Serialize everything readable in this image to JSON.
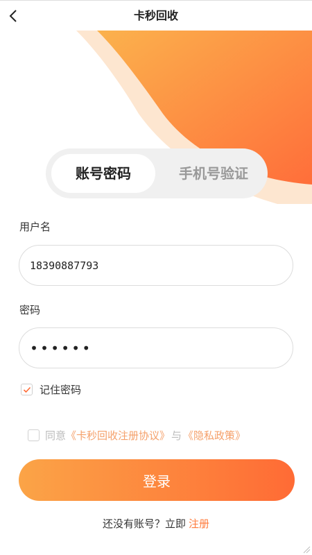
{
  "header": {
    "title": "卡秒回收"
  },
  "tabs": [
    {
      "label": "账号密码",
      "active": true
    },
    {
      "label": "手机号验证",
      "active": false
    }
  ],
  "form": {
    "username_label": "用户名",
    "username_value": "18390887793",
    "password_label": "密码",
    "password_value": "••••••",
    "remember_label": "记住密码",
    "remember_checked": true
  },
  "agreement": {
    "prefix": "同意",
    "terms_link": "《卡秒回收注册协议》",
    "joiner": "与",
    "privacy_link": "《隐私政策》",
    "checked": false
  },
  "login_button": "登录",
  "register": {
    "prompt": "还没有账号？立即",
    "link": "注册"
  },
  "colors": {
    "accent_start": "#fba447",
    "accent_end": "#ff6b35",
    "link": "#ff7a3a"
  }
}
